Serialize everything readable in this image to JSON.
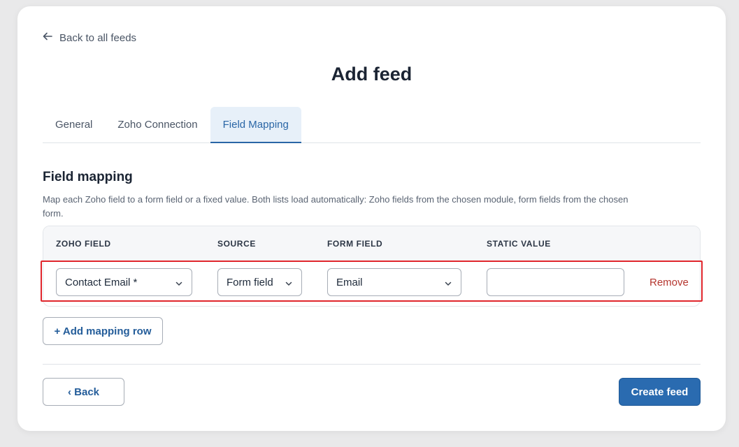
{
  "nav": {
    "back_label": "Back to all feeds"
  },
  "page": {
    "title": "Add feed"
  },
  "tabs": [
    {
      "label": "General",
      "active": false
    },
    {
      "label": "Zoho Connection",
      "active": false
    },
    {
      "label": "Field Mapping",
      "active": true
    }
  ],
  "section": {
    "title": "Field mapping",
    "description": "Map each Zoho field to a form field or a fixed value. Both lists load automatically: Zoho fields from the chosen module, form fields from the chosen form."
  },
  "table": {
    "headers": [
      "ZOHO FIELD",
      "SOURCE",
      "FORM FIELD",
      "STATIC VALUE"
    ],
    "rows": [
      {
        "zoho_field": "Contact Email *",
        "source": "Form field",
        "form_field": "Email",
        "static_value": "",
        "remove_label": "Remove"
      }
    ]
  },
  "actions": {
    "add_row_label": "+ Add mapping row",
    "back_label": "‹ Back",
    "create_label": "Create feed"
  },
  "colors": {
    "accent": "#2a6bb0",
    "highlight": "#e0262c",
    "danger": "#b5362f"
  }
}
